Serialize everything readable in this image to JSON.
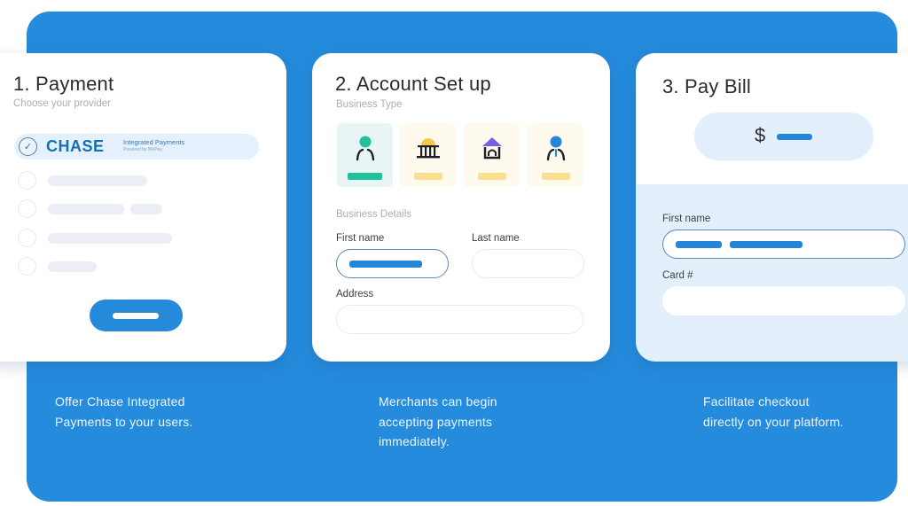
{
  "colors": {
    "brand_blue": "#258bdc",
    "field_fill": "#2486d8",
    "selected_teal": "#21c19d",
    "tile_yellow": "#fbe08e",
    "chase_blue": "#1670b4"
  },
  "steps": [
    {
      "title": "1. Payment",
      "subtitle": "Choose your provider",
      "selected_provider": {
        "logo_text": "CHASE",
        "tagline": "Integrated Payments",
        "powered_by": "Powered by WePay",
        "check_icon": "✓"
      },
      "other_providers_count": 4,
      "caption_lines": [
        "Offer Chase Integrated",
        "Payments to your users."
      ]
    },
    {
      "title": "2. Account Set up",
      "business_type_label": "Business Type",
      "business_types": [
        {
          "icon": "person-teal-icon",
          "selected": true
        },
        {
          "icon": "bank-icon",
          "selected": false
        },
        {
          "icon": "house-icon",
          "selected": false
        },
        {
          "icon": "person-tie-icon",
          "selected": false
        }
      ],
      "business_details_label": "Business Details",
      "fields": {
        "first_name_label": "First name",
        "last_name_label": "Last name",
        "address_label": "Address"
      },
      "caption_lines": [
        "Merchants can begin",
        "accepting payments",
        "immediately."
      ]
    },
    {
      "title": "3. Pay Bill",
      "currency_symbol": "$",
      "fields": {
        "first_name_label": "First name",
        "card_label": "Card #"
      },
      "caption_lines": [
        "Facilitate checkout",
        "directly on your platform."
      ]
    }
  ]
}
